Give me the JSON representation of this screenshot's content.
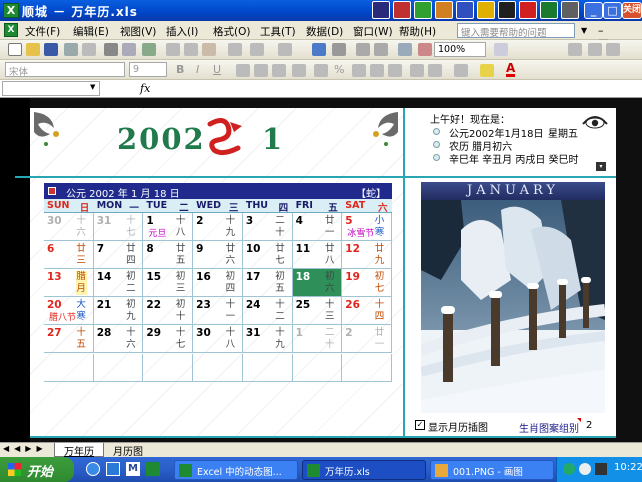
{
  "window": {
    "title": "顺城 － 万年历.xls",
    "app_icon": "X",
    "caption_tag": "关闭"
  },
  "menu": [
    "文件(F)",
    "编辑(E)",
    "视图(V)",
    "插入(I)",
    "格式(O)",
    "工具(T)",
    "数据(D)",
    "窗口(W)",
    "帮助(H)"
  ],
  "help_placeholder": "键入需要帮助的问题",
  "toolbar": {
    "zoom": "100%",
    "font_name": "宋体",
    "font_size": "9"
  },
  "formula": {
    "fx": "fx"
  },
  "banner": {
    "year": "2002",
    "month": "1"
  },
  "calendar": {
    "header": "公元  2002  年  1  月  18  日",
    "zodiac": "【蛇】",
    "day_headers": [
      {
        "en": "SUN",
        "cn": "日"
      },
      {
        "en": "MON",
        "cn": "一"
      },
      {
        "en": "TUE",
        "cn": "二"
      },
      {
        "en": "WED",
        "cn": "三"
      },
      {
        "en": "THU",
        "cn": "四"
      },
      {
        "en": "FRI",
        "cn": "五"
      },
      {
        "en": "SAT",
        "cn": "六"
      }
    ],
    "weeks": [
      [
        {
          "d": "30",
          "l": "十六"
        },
        {
          "d": "31",
          "l": "十七"
        },
        {
          "d": "1",
          "l": "十八",
          "f": "元旦"
        },
        {
          "d": "2",
          "l": "十九"
        },
        {
          "d": "3",
          "l": "二十"
        },
        {
          "d": "4",
          "l": "廿一"
        },
        {
          "d": "5",
          "l": "小寒",
          "f": "冰雪节"
        }
      ],
      [
        {
          "d": "6",
          "l": "廿三"
        },
        {
          "d": "7",
          "l": "廿四"
        },
        {
          "d": "8",
          "l": "廿五"
        },
        {
          "d": "9",
          "l": "廿六"
        },
        {
          "d": "10",
          "l": "廿七"
        },
        {
          "d": "11",
          "l": "廿八"
        },
        {
          "d": "12",
          "l": "廿九"
        }
      ],
      [
        {
          "d": "13",
          "l": "腊月"
        },
        {
          "d": "14",
          "l": "初二"
        },
        {
          "d": "15",
          "l": "初三"
        },
        {
          "d": "16",
          "l": "初四"
        },
        {
          "d": "17",
          "l": "初五"
        },
        {
          "d": "18",
          "l": "初六"
        },
        {
          "d": "19",
          "l": "初七"
        }
      ],
      [
        {
          "d": "20",
          "l": "大寒",
          "f": "腊八节"
        },
        {
          "d": "21",
          "l": "初九"
        },
        {
          "d": "22",
          "l": "初十"
        },
        {
          "d": "23",
          "l": "十一"
        },
        {
          "d": "24",
          "l": "十二"
        },
        {
          "d": "25",
          "l": "十三"
        },
        {
          "d": "26",
          "l": "十四"
        }
      ],
      [
        {
          "d": "27",
          "l": "十五"
        },
        {
          "d": "28",
          "l": "十六"
        },
        {
          "d": "29",
          "l": "十七"
        },
        {
          "d": "30",
          "l": "十八"
        },
        {
          "d": "31",
          "l": "十九"
        },
        {
          "d": "1",
          "l": "二十"
        },
        {
          "d": "2",
          "l": "廿一"
        }
      ],
      [
        {
          "d": "",
          "l": ""
        },
        {
          "d": "",
          "l": ""
        },
        {
          "d": "",
          "l": ""
        },
        {
          "d": "",
          "l": ""
        },
        {
          "d": "",
          "l": ""
        },
        {
          "d": "",
          "l": ""
        },
        {
          "d": "",
          "l": ""
        }
      ]
    ],
    "colors": {
      "sun": "#e0261c",
      "sat": "#e0261c",
      "weekday": "#000000",
      "gray": "#b0b0b0",
      "today": "#2e8f58",
      "festival": "#c000c0"
    }
  },
  "info": {
    "greeting": "上午好！现在是：",
    "gregorian": "公元2002年1月18日",
    "weekday": "星期五",
    "lunar": "农历  腊月初六",
    "ganzhi": "辛巳年  辛丑月  丙戌日  癸巳时",
    "month_name": "JANUARY"
  },
  "bottom": {
    "show_label": "显示月历插图",
    "group_label": "生肖图案组别",
    "group_value": "2"
  },
  "sheet_tabs": [
    "万年历",
    "月历图"
  ],
  "taskbar": {
    "start": "开始",
    "tasks": [
      "Excel 中的动态图...",
      "万年历.xls",
      "001.PNG - 画图"
    ],
    "clock": "10:22"
  }
}
